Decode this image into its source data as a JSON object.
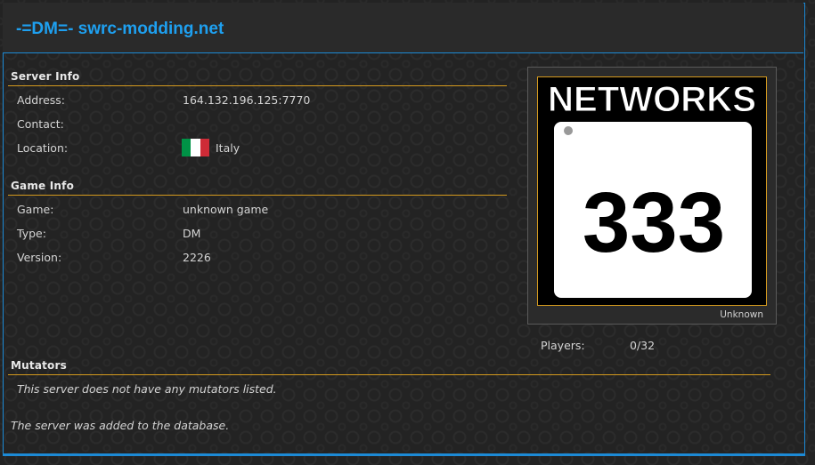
{
  "header": {
    "title": "-=DM=- swrc-modding.net"
  },
  "server_info": {
    "title": "Server Info",
    "rows": [
      {
        "label": "Address:",
        "value": "164.132.196.125:7770"
      },
      {
        "label": "Contact:",
        "value": ""
      },
      {
        "label": "Location:",
        "value": "Italy"
      }
    ],
    "flag_colors": [
      "#009246",
      "#ffffff",
      "#ce2b37"
    ]
  },
  "game_info": {
    "title": "Game Info",
    "rows": [
      {
        "label": "Game:",
        "value": "unknown game"
      },
      {
        "label": "Type:",
        "value": "DM"
      },
      {
        "label": "Version:",
        "value": "2226"
      }
    ]
  },
  "map": {
    "image_text_top": "NETWORKS",
    "image_text_number": "333",
    "caption": "Unknown"
  },
  "players": {
    "label": "Players:",
    "value": "0/32"
  },
  "mutators": {
    "title": "Mutators",
    "empty_text": "This server does not have any mutators listed."
  },
  "log": {
    "text": "The server was added to the database."
  },
  "colors": {
    "accent_blue": "#1ea0f0",
    "rule_orange": "#d49a1e",
    "frame_blue": "#1c8ad6"
  }
}
